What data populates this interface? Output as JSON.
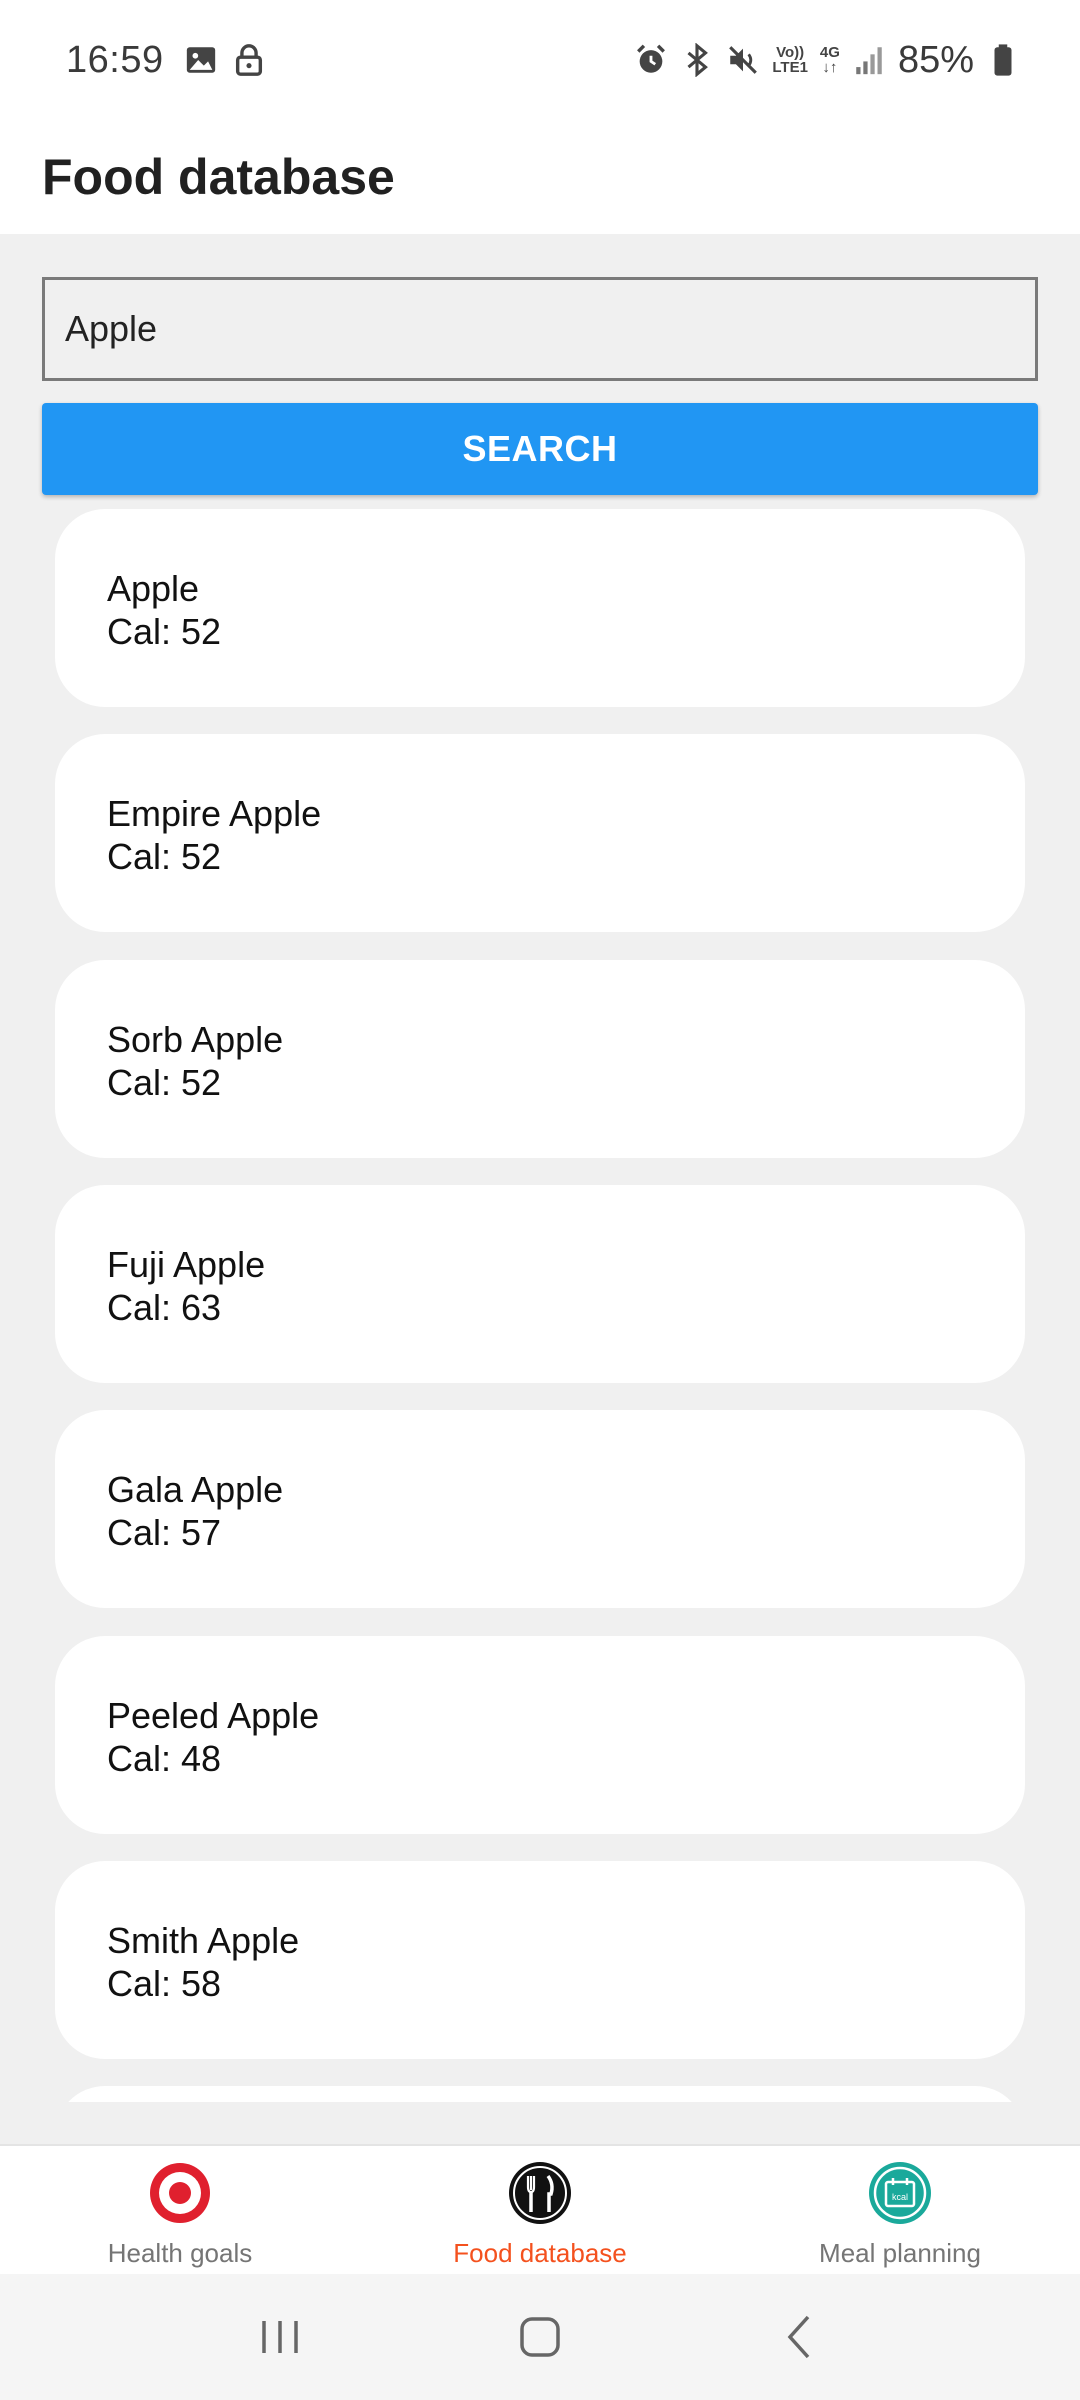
{
  "status_bar": {
    "time": "16:59",
    "network_top": "Vo))",
    "network_bottom": "LTE1",
    "data_label": "4G",
    "battery": "85%"
  },
  "app_bar": {
    "title": "Food database"
  },
  "search": {
    "value": "Apple",
    "button_label": "SEARCH"
  },
  "results": [
    {
      "name": "Apple",
      "cal": "Cal: 52"
    },
    {
      "name": "Empire Apple",
      "cal": "Cal: 52"
    },
    {
      "name": "Sorb Apple",
      "cal": "Cal: 52"
    },
    {
      "name": "Fuji Apple",
      "cal": "Cal: 63"
    },
    {
      "name": "Gala Apple",
      "cal": "Cal: 57"
    },
    {
      "name": "Peeled Apple",
      "cal": "Cal: 48"
    },
    {
      "name": "Smith Apple",
      "cal": "Cal: 58"
    },
    {
      "name": "",
      "cal": ""
    }
  ],
  "bottom_nav": {
    "items": [
      {
        "label": "Health goals",
        "icon": "target-icon",
        "active": false
      },
      {
        "label": "Food database",
        "icon": "fork-knife-icon",
        "active": true
      },
      {
        "label": "Meal planning",
        "icon": "kcal-calendar-icon",
        "active": false
      }
    ],
    "kcal_text": "kcal"
  },
  "colors": {
    "accent": "#2196f3",
    "active_nav": "#f4511e",
    "target_red": "#e0202e",
    "meal_teal": "#1aa99b"
  }
}
